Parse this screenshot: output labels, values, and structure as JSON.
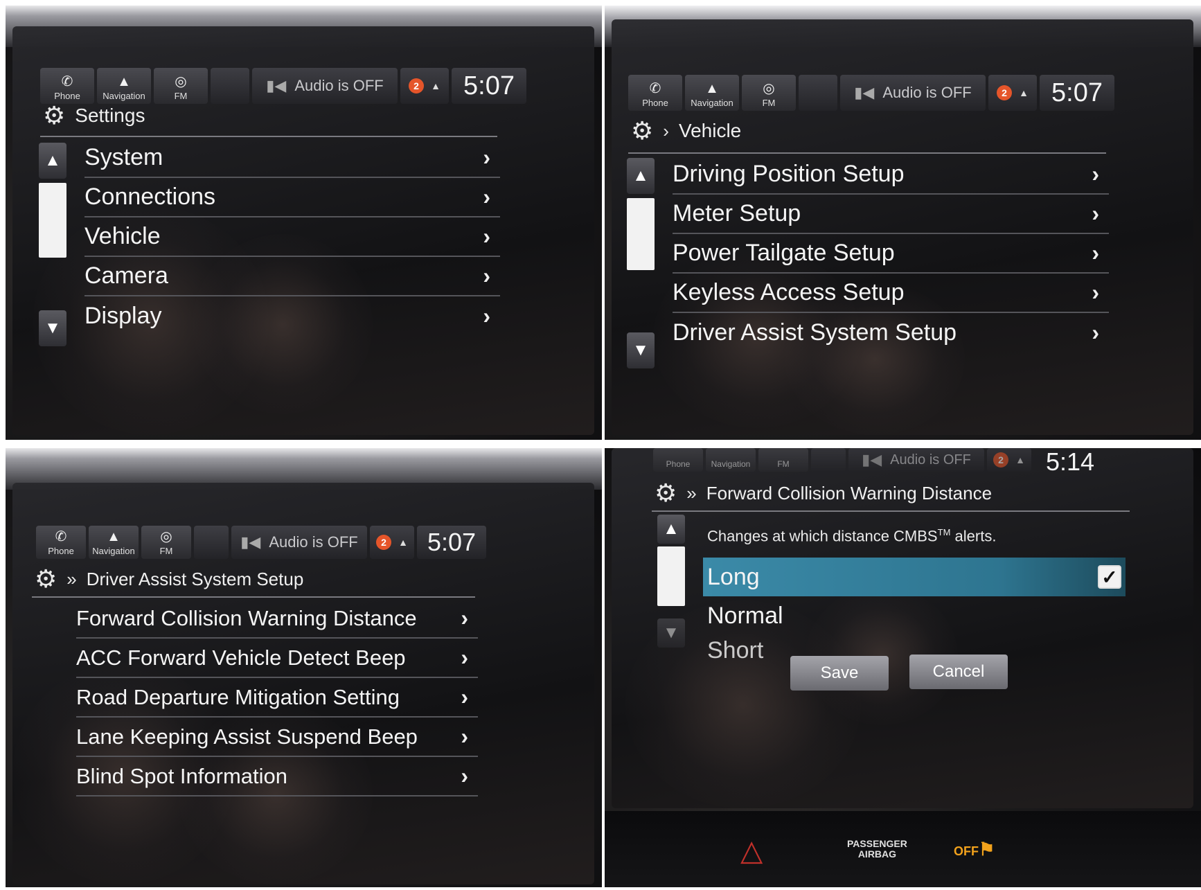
{
  "status": {
    "phone_label": "Phone",
    "navigation_label": "Navigation",
    "fm_label": "FM",
    "audio_text": "Audio is OFF",
    "notification_count": "2"
  },
  "panel1": {
    "time": "5:07",
    "title": "Settings",
    "items": [
      "System",
      "Connections",
      "Vehicle",
      "Camera",
      "Display"
    ]
  },
  "panel2": {
    "time": "5:07",
    "title": "Vehicle",
    "items": [
      "Driving Position Setup",
      "Meter Setup",
      "Power Tailgate Setup",
      "Keyless Access Setup",
      "Driver Assist System Setup"
    ]
  },
  "panel3": {
    "time": "5:07",
    "title": "Driver Assist System Setup",
    "items": [
      "Forward Collision Warning Distance",
      "ACC Forward Vehicle Detect Beep",
      "Road Departure Mitigation Setting",
      "Lane Keeping Assist Suspend Beep",
      "Blind Spot Information"
    ]
  },
  "panel4": {
    "time": "5:14",
    "title": "Forward Collision Warning Distance",
    "description_pre": "Changes at which distance CMBS",
    "description_sup": "TM",
    "description_post": " alerts.",
    "options": [
      "Long",
      "Normal",
      "Short"
    ],
    "selected_option": "Long",
    "save_label": "Save",
    "cancel_label": "Cancel",
    "dash_airbag_label_1": "PASSENGER",
    "dash_airbag_label_2": "AIRBAG",
    "dash_airbag_off": "OFF"
  },
  "icons": {
    "phone": "phone-icon",
    "navigation": "navigation-icon",
    "fm": "radio-icon",
    "settings": "gear-icon",
    "speaker": "speaker-muted-icon",
    "chevron": "chevron-right-icon",
    "scroll_up": "scroll-up-icon",
    "scroll_down": "scroll-down-icon",
    "check": "checkmark-icon",
    "hazard": "hazard-triangle-icon"
  },
  "colors": {
    "selected_row": "#3b8aa8",
    "notification_badge": "#e5552a",
    "airbag_off": "#f2a21c",
    "hazard": "#c0302a"
  }
}
